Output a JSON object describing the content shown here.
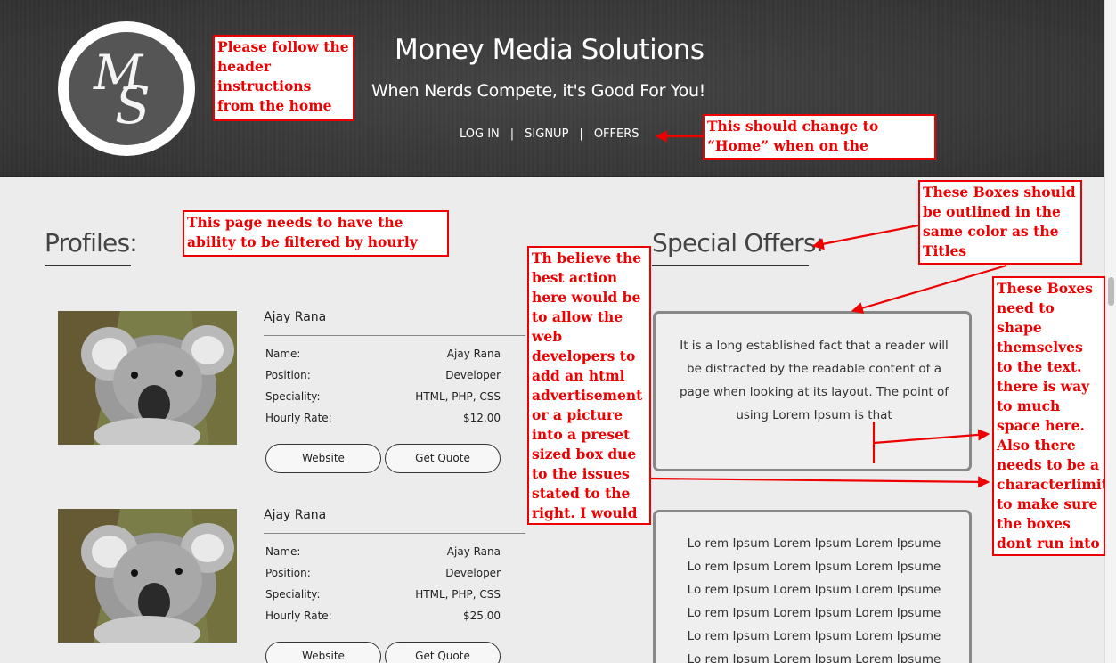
{
  "header": {
    "logo_letters": "MS",
    "site_title": "Money Media Solutions",
    "tagline": "When Nerds Compete, it's Good For You!",
    "nav": [
      {
        "label": "LOG IN"
      },
      {
        "label": "SIGNUP"
      },
      {
        "label": "OFFERS"
      }
    ],
    "nav_separator": "|"
  },
  "profiles": {
    "title": "Profiles:",
    "field_labels": {
      "name": "Name:",
      "position": "Position:",
      "speciality": "Speciality:",
      "rate": "Hourly Rate:"
    },
    "buttons": {
      "website": "Website",
      "quote": "Get Quote"
    },
    "items": [
      {
        "display_name": "Ajay Rana",
        "name": "Ajay Rana",
        "position": "Developer",
        "speciality": "HTML, PHP, CSS",
        "rate": "$12.00"
      },
      {
        "display_name": "Ajay Rana",
        "name": "Ajay Rana",
        "position": "Developer",
        "speciality": "HTML, PHP, CSS",
        "rate": "$25.00"
      }
    ]
  },
  "offers": {
    "title": "Special Offers:",
    "box1_text": "It is a long established fact that a reader will be distracted by the readable content of a page when looking at its layout. The point of using Lorem Ipsum is that",
    "box2_lines": [
      "Lo rem Ipsum Lorem Ipsum Lorem Ipsume",
      "Lo rem Ipsum Lorem Ipsum Lorem Ipsume",
      "Lo rem Ipsum Lorem Ipsum Lorem Ipsume",
      "Lo rem Ipsum Lorem Ipsum Lorem Ipsume",
      "Lo rem Ipsum Lorem Ipsum Lorem Ipsume",
      "Lo rem Ipsum Lorem Ipsum Lorem Ipsume"
    ]
  },
  "annotations": {
    "header_note": "Please follow the header instructions from the home page",
    "nav_note": "This should change to “Home” when on the specials page",
    "filter_note": "This page needs to have the ability to be filtered by hourly rate as well",
    "outline_note": "These Boxes should be outlined in the same color as the Titles",
    "ad_note": "Th believe the best action here would be to allow the web developers to add an html advertisement or a picture into a preset sized box due to the issues stated to the right. I would much rather this.",
    "shape_note": "These Boxes need to shape themselves to the text. there is way to much space here. Also there needs to be a characterlimit to make sure the boxes dont run into each other."
  },
  "colors": {
    "annotation": "#e00000",
    "header_bg": "#3c3c3c",
    "page_bg": "#ececec"
  }
}
